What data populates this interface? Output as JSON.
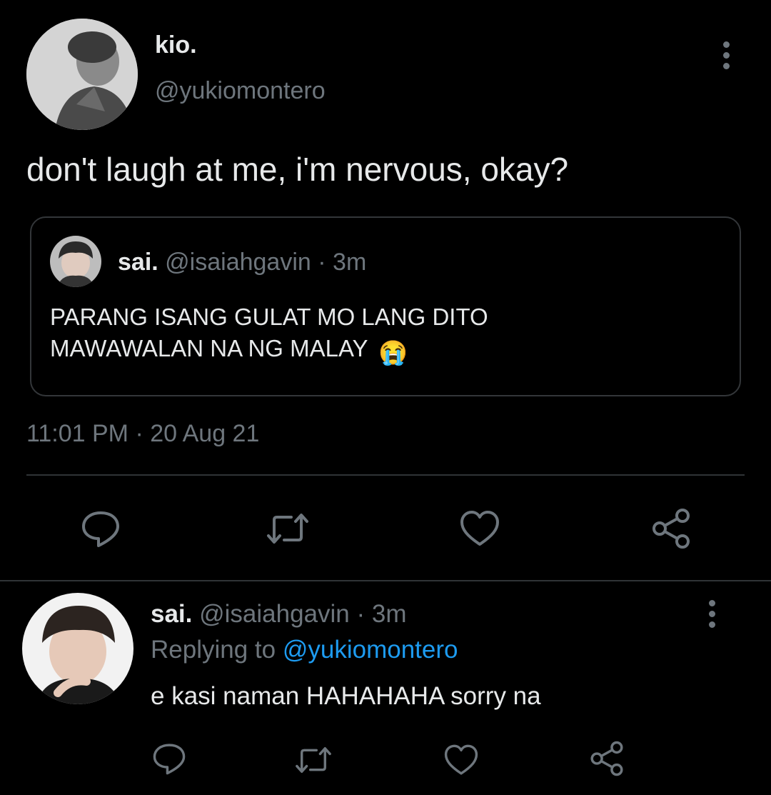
{
  "main_tweet": {
    "display_name": "kio.",
    "handle": "@yukiomontero",
    "text": "don't laugh at me, i'm nervous, okay?",
    "timestamp": "11:01 PM · 20 Aug 21",
    "avatar_icon": "user-avatar-kio",
    "more_icon": "more-vertical-icon"
  },
  "quoted_tweet": {
    "display_name": "sai.",
    "handle": "@isaiahgavin",
    "age": "· 3m",
    "text": "PARANG ISANG GULAT MO LANG DITO MAWAWALAN NA NG MALAY",
    "emoji": "😭"
  },
  "actions": {
    "icons": [
      "reply-icon",
      "retweet-icon",
      "like-icon",
      "share-icon"
    ]
  },
  "reply": {
    "display_name": "sai.",
    "handle": "@isaiahgavin",
    "age": "· 3m",
    "replying_to_label": "Replying to",
    "replying_to_handle": "@yukiomontero",
    "text": "e kasi naman HAHAHAHA sorry na"
  },
  "colors": {
    "background": "#000000",
    "text": "#e7e9ea",
    "muted": "#6e767d",
    "link": "#1d9bf0",
    "border": "#333639"
  }
}
